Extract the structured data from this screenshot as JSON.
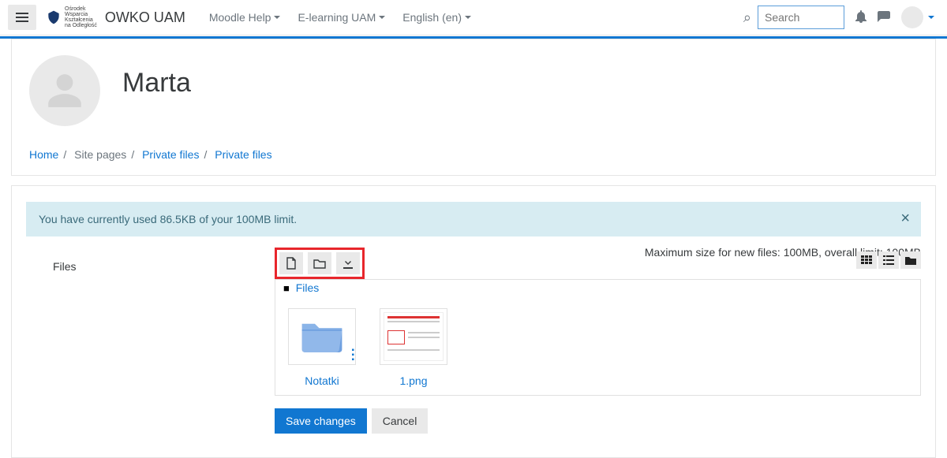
{
  "navbar": {
    "brand": "OWKO UAM",
    "logo_lines": [
      "Ośrodek",
      "Wsparcia",
      "Kształcenia",
      "na Odległość"
    ],
    "links": [
      "Moodle Help",
      "E-learning UAM",
      "English (en)"
    ],
    "search_placeholder": "Search"
  },
  "profile": {
    "name": "Marta"
  },
  "breadcrumb": {
    "home": "Home",
    "site_pages": "Site pages",
    "pf1": "Private files",
    "pf2": "Private files"
  },
  "alert": {
    "text": "You have currently used 86.5KB of your 100MB limit."
  },
  "limits": {
    "text": "Maximum size for new files: 100MB, overall limit: 100MB"
  },
  "files": {
    "label": "Files",
    "crumb": "Files",
    "items": [
      {
        "name": "Notatki",
        "kind": "folder"
      },
      {
        "name": "1.png",
        "kind": "image"
      }
    ]
  },
  "actions": {
    "save": "Save changes",
    "cancel": "Cancel"
  }
}
